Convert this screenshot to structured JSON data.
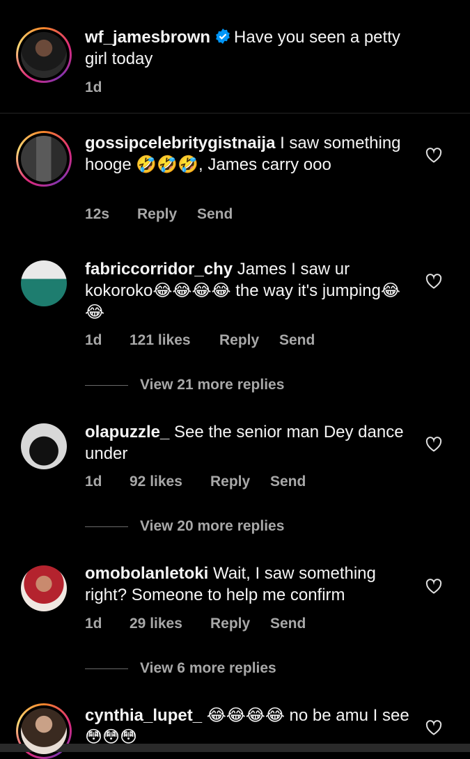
{
  "caption": {
    "username": "wf_jamesbrown",
    "text": "Have you seen a petty girl today",
    "time": "1d"
  },
  "comments": [
    {
      "username": "gossipcelebritygistnaija",
      "text": "I saw something hooge 🤣🤣🤣, James carry ooo",
      "time": "12s",
      "reply": "Reply",
      "send": "Send"
    },
    {
      "username": "fabriccorridor_chy",
      "text": "James I saw ur kokoroko😂😂😂😂 the way it's jumping😂😂",
      "time": "1d",
      "likes": "121 likes",
      "reply": "Reply",
      "send": "Send",
      "more_replies": "View 21 more replies"
    },
    {
      "username": "olapuzzle_",
      "text": "See the senior man Dey dance under",
      "time": "1d",
      "likes": "92 likes",
      "reply": "Reply",
      "send": "Send",
      "more_replies": "View 20 more replies"
    },
    {
      "username": "omobolanletoki",
      "text": "Wait, I saw something right? Someone to help me confirm",
      "time": "1d",
      "likes": "29 likes",
      "reply": "Reply",
      "send": "Send",
      "more_replies": "View 6 more replies"
    },
    {
      "username": "cynthia_lupet_",
      "text": "😂😂😂😂 no be amu I see 😳😳😳"
    }
  ],
  "icons": {
    "verified": "verified-badge-icon",
    "like": "heart-outline-icon"
  },
  "colors": {
    "background": "#000000",
    "text": "#f5f5f5",
    "secondary": "#a8a8a8",
    "verified": "#0095f6"
  }
}
